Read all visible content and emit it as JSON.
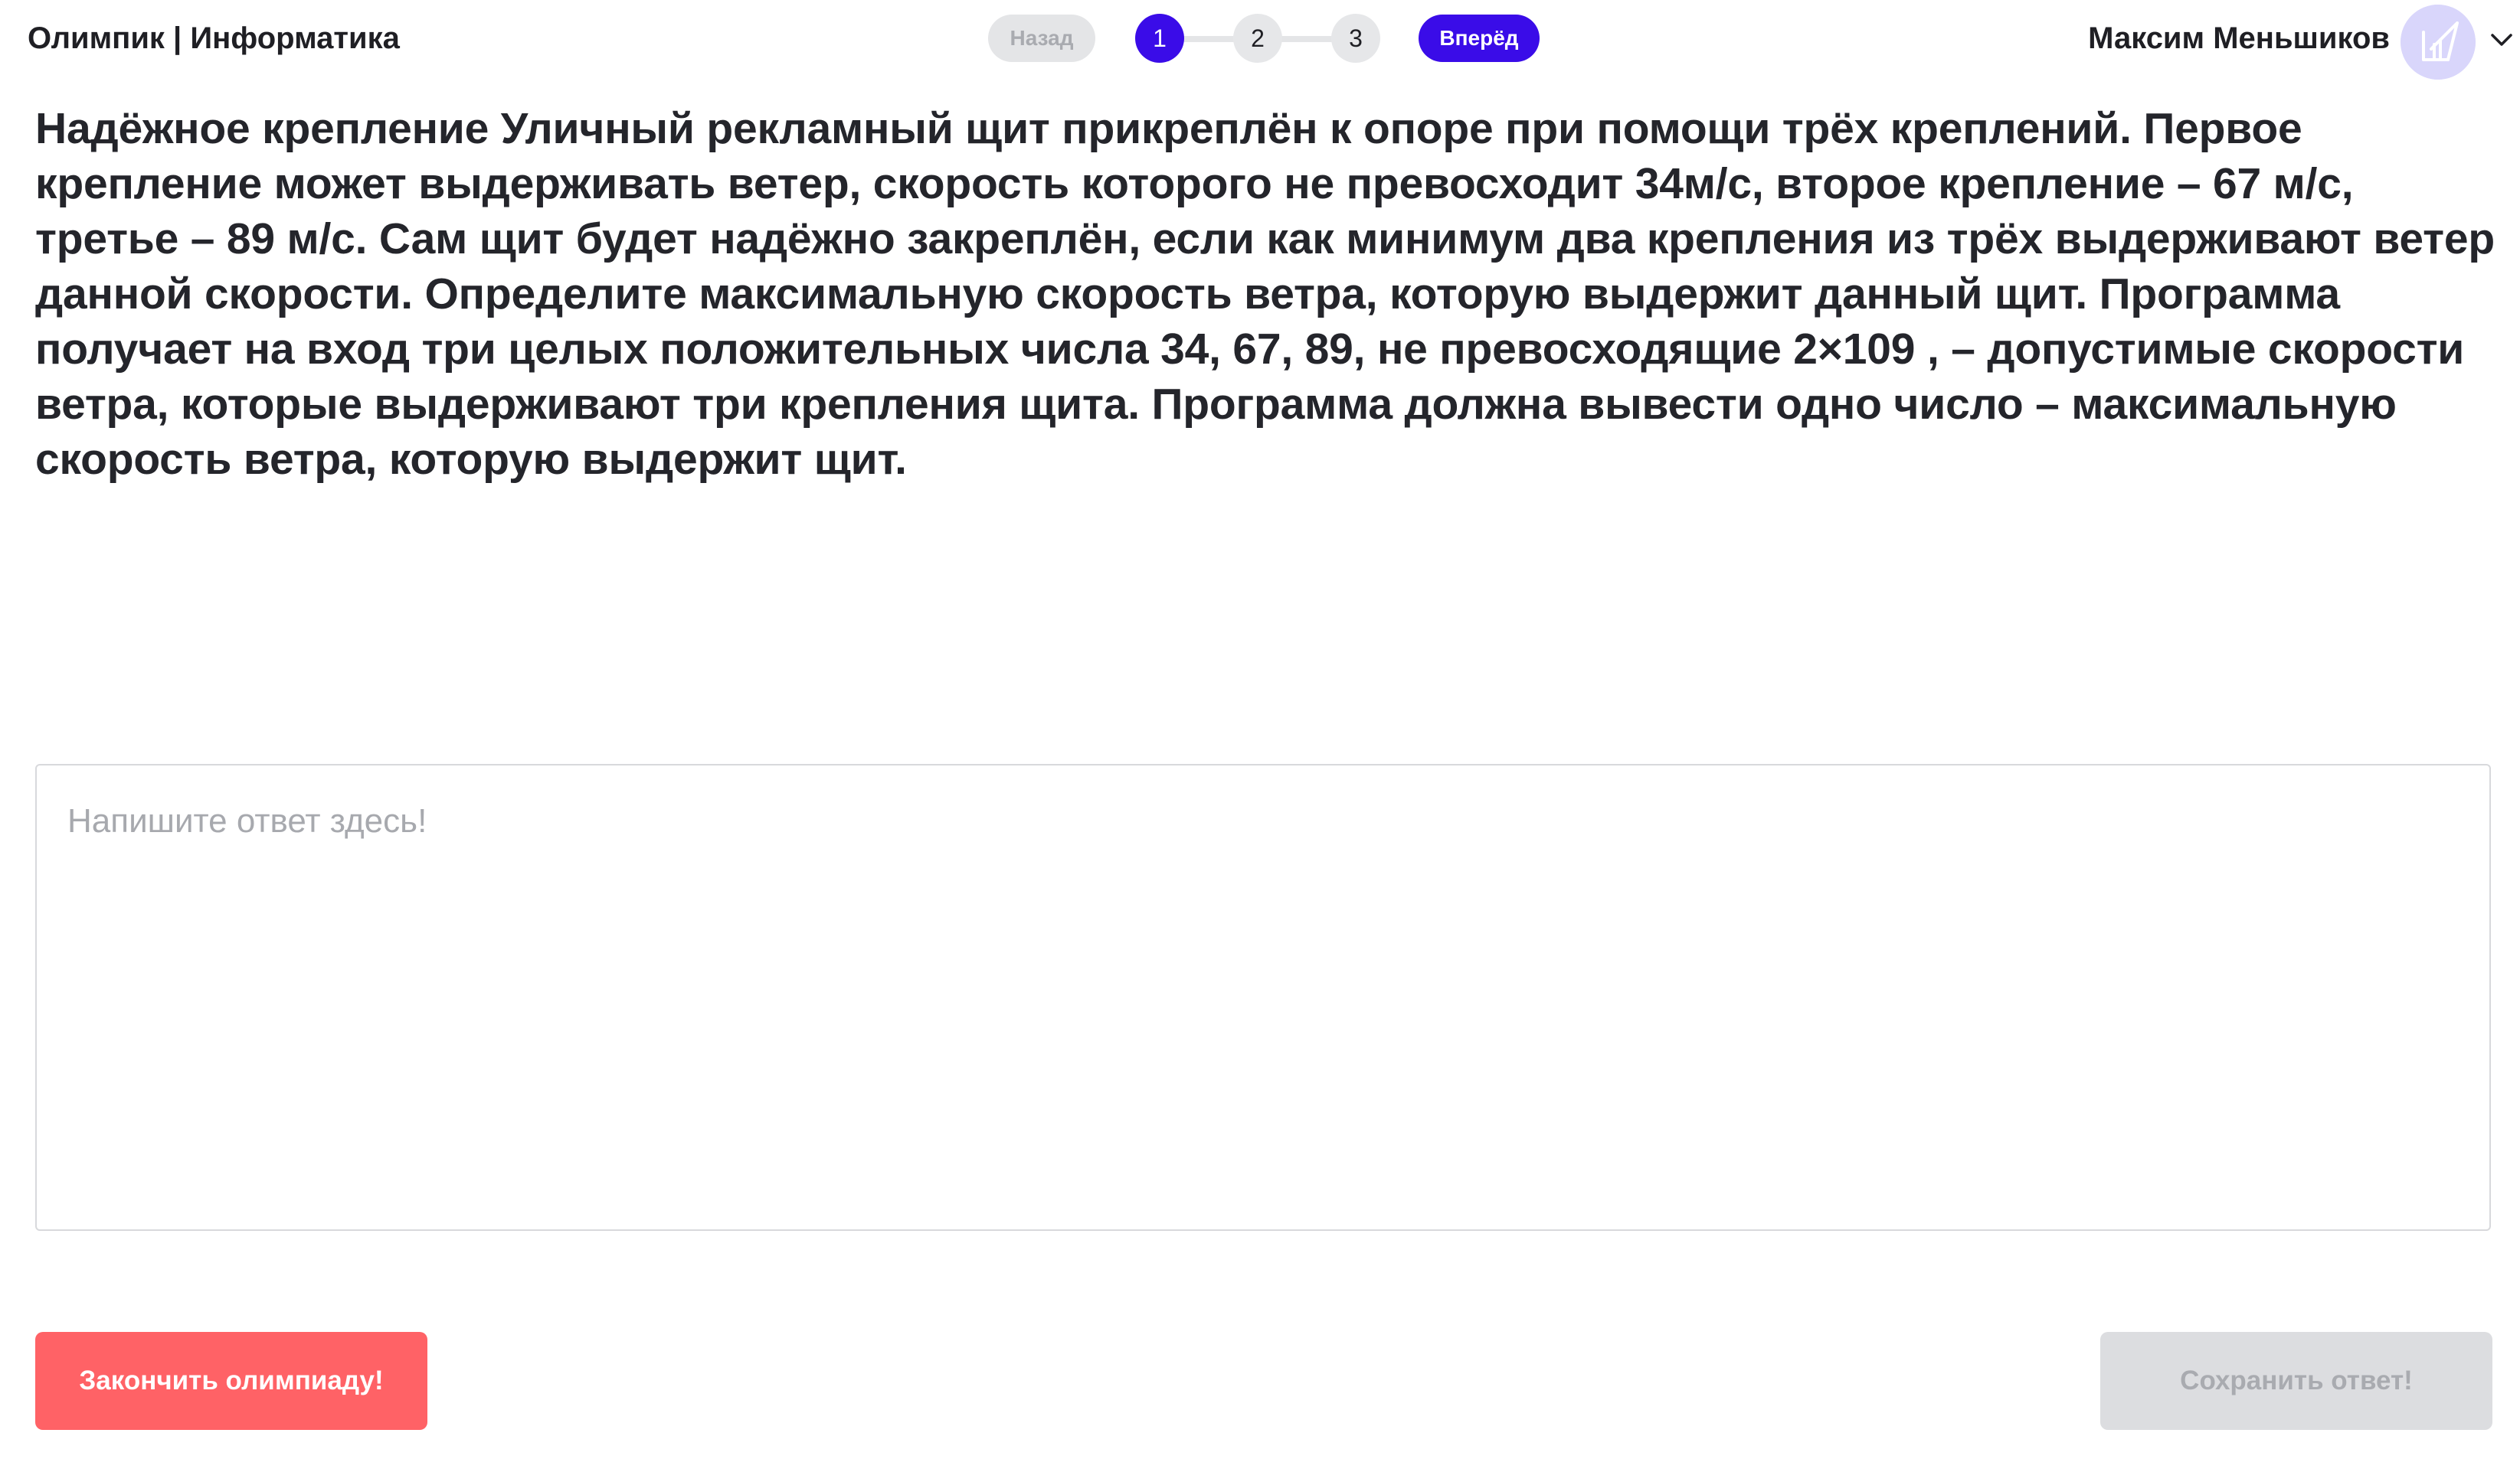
{
  "header": {
    "app_title": "Олимпик | Информатика",
    "back_label": "Назад",
    "next_label": "Вперёд",
    "steps": [
      "1",
      "2",
      "3"
    ],
    "current_step": 1,
    "user_name": "Максим Меньшиков",
    "avatar_icon": "avatar-logo-icon",
    "menu_icon": "chevron-down-icon"
  },
  "question": {
    "text": "Надёжное крепление Уличный рекламный щит прикреплён к опоре при помощи трёх креплений. Первое крепление может выдерживать ветер, скорость которого не превосходит 34м/с, второе крепление – 67 м/с, третье – 89 м/с. Сам щит будет надёжно закреплён, если как минимум два крепления из трёх выдерживают ветер данной скорости. Определите максимальную скорость ветра, которую выдержит данный щит. Программа получает на вход три целых положительных числа 34, 67, 89, не превосходящие 2×109 , – допустимые скорости ветра, которые выдерживают три крепления щита. Программа должна вывести одно число – максимальную скорость ветра, которую выдержит щит."
  },
  "answer": {
    "value": "",
    "placeholder": "Напишите ответ здесь!"
  },
  "footer": {
    "finish_label": "Закончить олимпиаду!",
    "save_label": "Сохранить ответ!"
  },
  "colors": {
    "accent": "#3a0ce8",
    "danger": "#ff6266",
    "disabled": "#dcdde0"
  }
}
